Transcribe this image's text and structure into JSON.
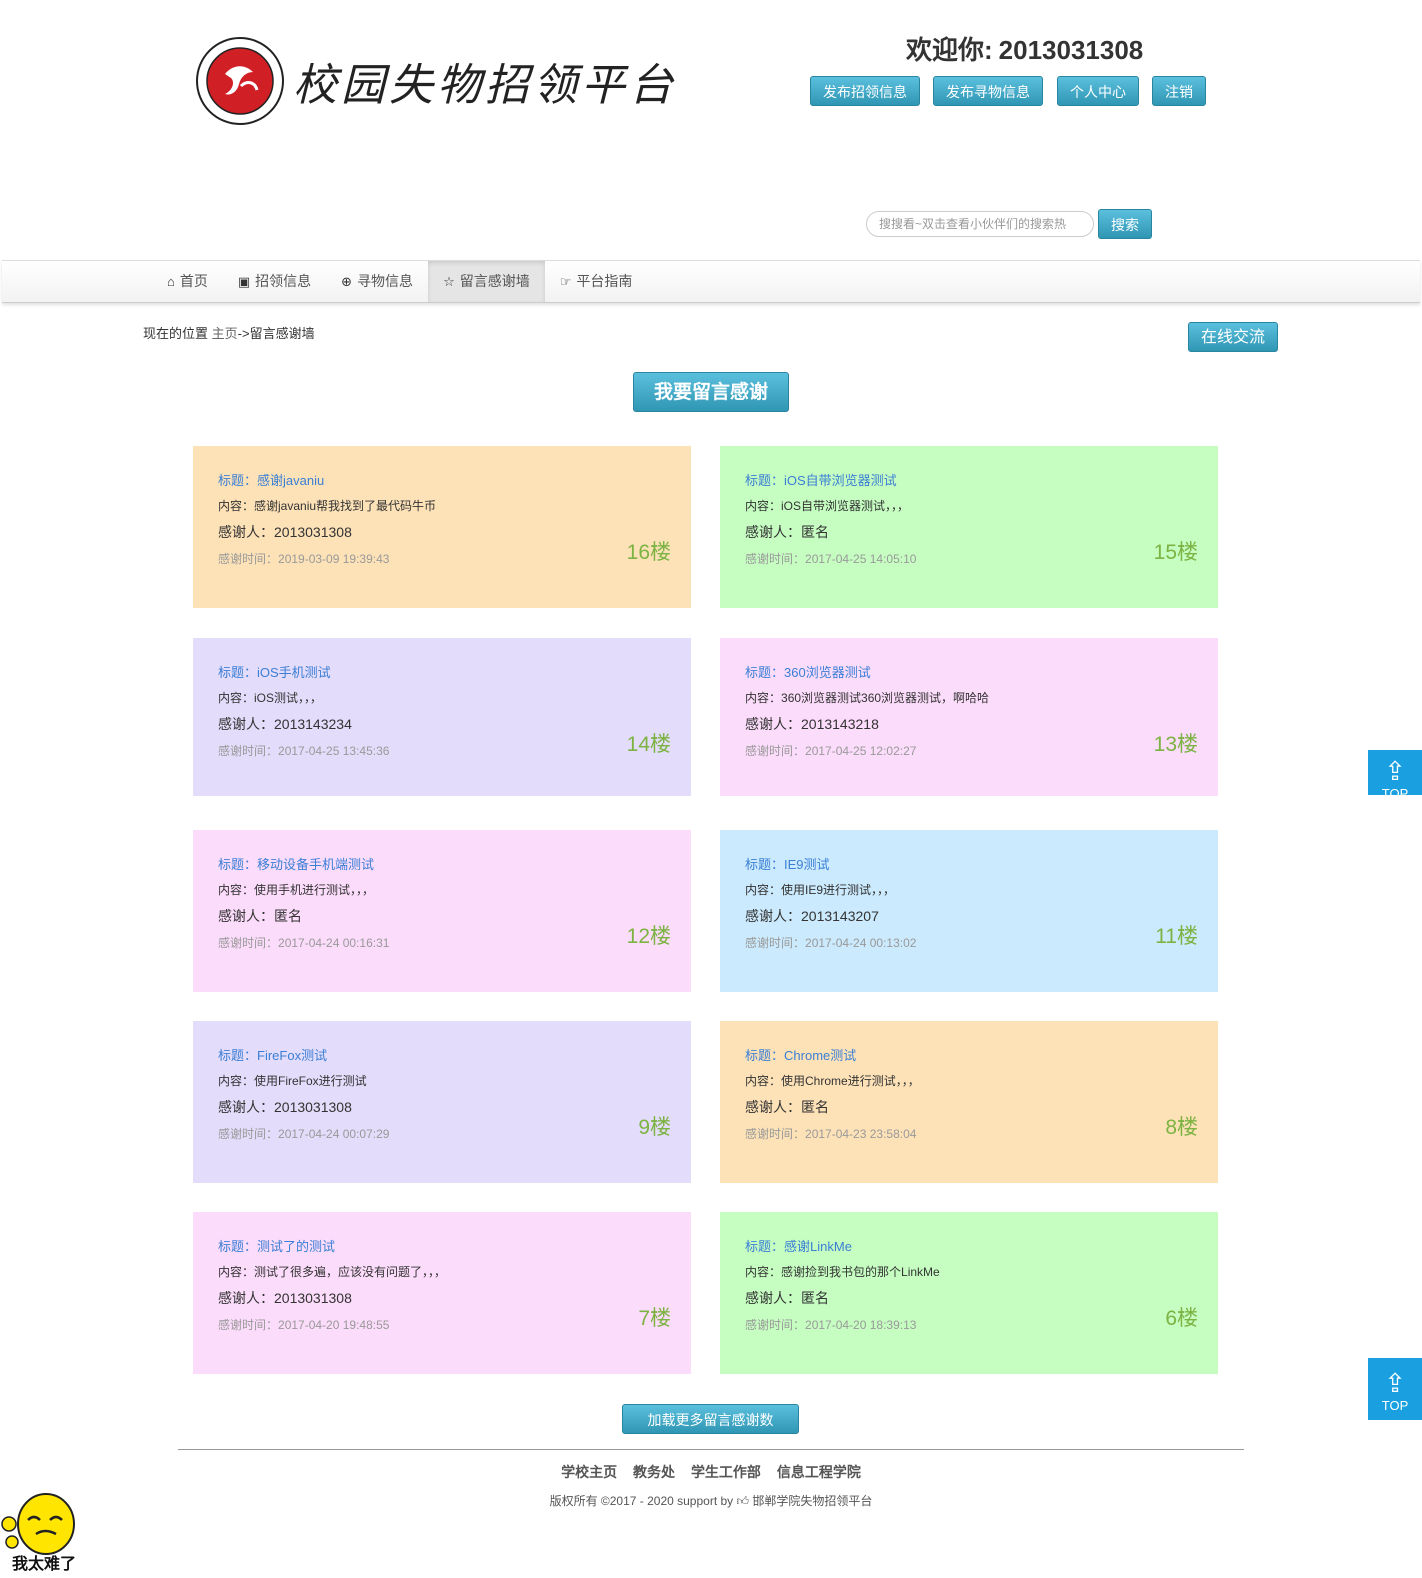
{
  "header": {
    "site_title": "校园失物招领平台",
    "welcome_label": "欢迎你:",
    "username": "2013031308",
    "buttons": [
      "发布招领信息",
      "发布寻物信息",
      "个人中心",
      "注销"
    ],
    "search_placeholder": "搜搜看~双击查看小伙伴们的搜索热",
    "search_button": "搜索"
  },
  "nav": {
    "items": [
      {
        "icon": "home-icon",
        "label": "首页"
      },
      {
        "icon": "picture-icon",
        "label": "招领信息"
      },
      {
        "icon": "zoom-icon",
        "label": "寻物信息"
      },
      {
        "icon": "star-icon",
        "label": "留言感谢墙"
      },
      {
        "icon": "hand-point-icon",
        "label": "平台指南"
      }
    ],
    "active_index": 3
  },
  "breadcrumb": {
    "prefix": "现在的位置",
    "home": "主页",
    "separator": "->",
    "current": "留言感谢墙"
  },
  "chat_button": "在线交流",
  "thank_button": "我要留言感谢",
  "labels": {
    "title": "标题：",
    "content": "内容：",
    "thanker": "感谢人：",
    "time": "感谢时间："
  },
  "cards": [
    {
      "title": "感谢javaniu",
      "content": "感谢javaniu帮我找到了最代码牛币",
      "thanker": "2013031308",
      "time": "2019-03-09 19:39:43",
      "floor": "16楼",
      "bg": "#fde2b8"
    },
    {
      "title": "iOS自带浏览器测试",
      "content": "iOS自带浏览器测试，，，",
      "thanker": "匿名",
      "time": "2017-04-25 14:05:10",
      "floor": "15楼",
      "bg": "#c6fec2"
    },
    {
      "title": "iOS手机测试",
      "content": "iOS测试，，，",
      "thanker": "2013143234",
      "time": "2017-04-25 13:45:36",
      "floor": "14楼",
      "bg": "#e4dcfb"
    },
    {
      "title": "360浏览器测试",
      "content": "360浏览器测试360浏览器测试，啊哈哈",
      "thanker": "2013143218",
      "time": "2017-04-25 12:02:27",
      "floor": "13楼",
      "bg": "#fcdcfb"
    },
    {
      "title": "移动设备手机端测试",
      "content": "使用手机进行测试，，，",
      "thanker": "匿名",
      "time": "2017-04-24 00:16:31",
      "floor": "12楼",
      "bg": "#fcdcfb"
    },
    {
      "title": "IE9测试",
      "content": "使用IE9进行测试，，，",
      "thanker": "2013143207",
      "time": "2017-04-24 00:13:02",
      "floor": "11楼",
      "bg": "#cbeafd"
    },
    {
      "title": "FireFox测试",
      "content": "使用FireFox进行测试",
      "thanker": "2013031308",
      "time": "2017-04-24 00:07:29",
      "floor": "9楼",
      "bg": "#e4dcfb"
    },
    {
      "title": "Chrome测试",
      "content": "使用Chrome进行测试，，，",
      "thanker": "匿名",
      "time": "2017-04-23 23:58:04",
      "floor": "8楼",
      "bg": "#fde2b8"
    },
    {
      "title": "测试了的测试",
      "content": "测试了很多遍，应该没有问题了，，，",
      "thanker": "2013031308",
      "time": "2017-04-20 19:48:55",
      "floor": "7楼",
      "bg": "#fcdcfb"
    },
    {
      "title": "感谢LinkMe",
      "content": "感谢捡到我书包的那个LinkMe",
      "thanker": "匿名",
      "time": "2017-04-20 18:39:13",
      "floor": "6楼",
      "bg": "#c6fec2"
    }
  ],
  "load_more": "加载更多留言感谢数据...",
  "footer": {
    "links": [
      "学校主页",
      "教务处",
      "学生工作部",
      "信息工程学院"
    ],
    "copyright": "版权所有 ©2017 - 2020 support by",
    "platform": "邯郸学院失物招领平台"
  },
  "top_button": {
    "label": "TOP"
  },
  "mascot_text": "我太难了"
}
